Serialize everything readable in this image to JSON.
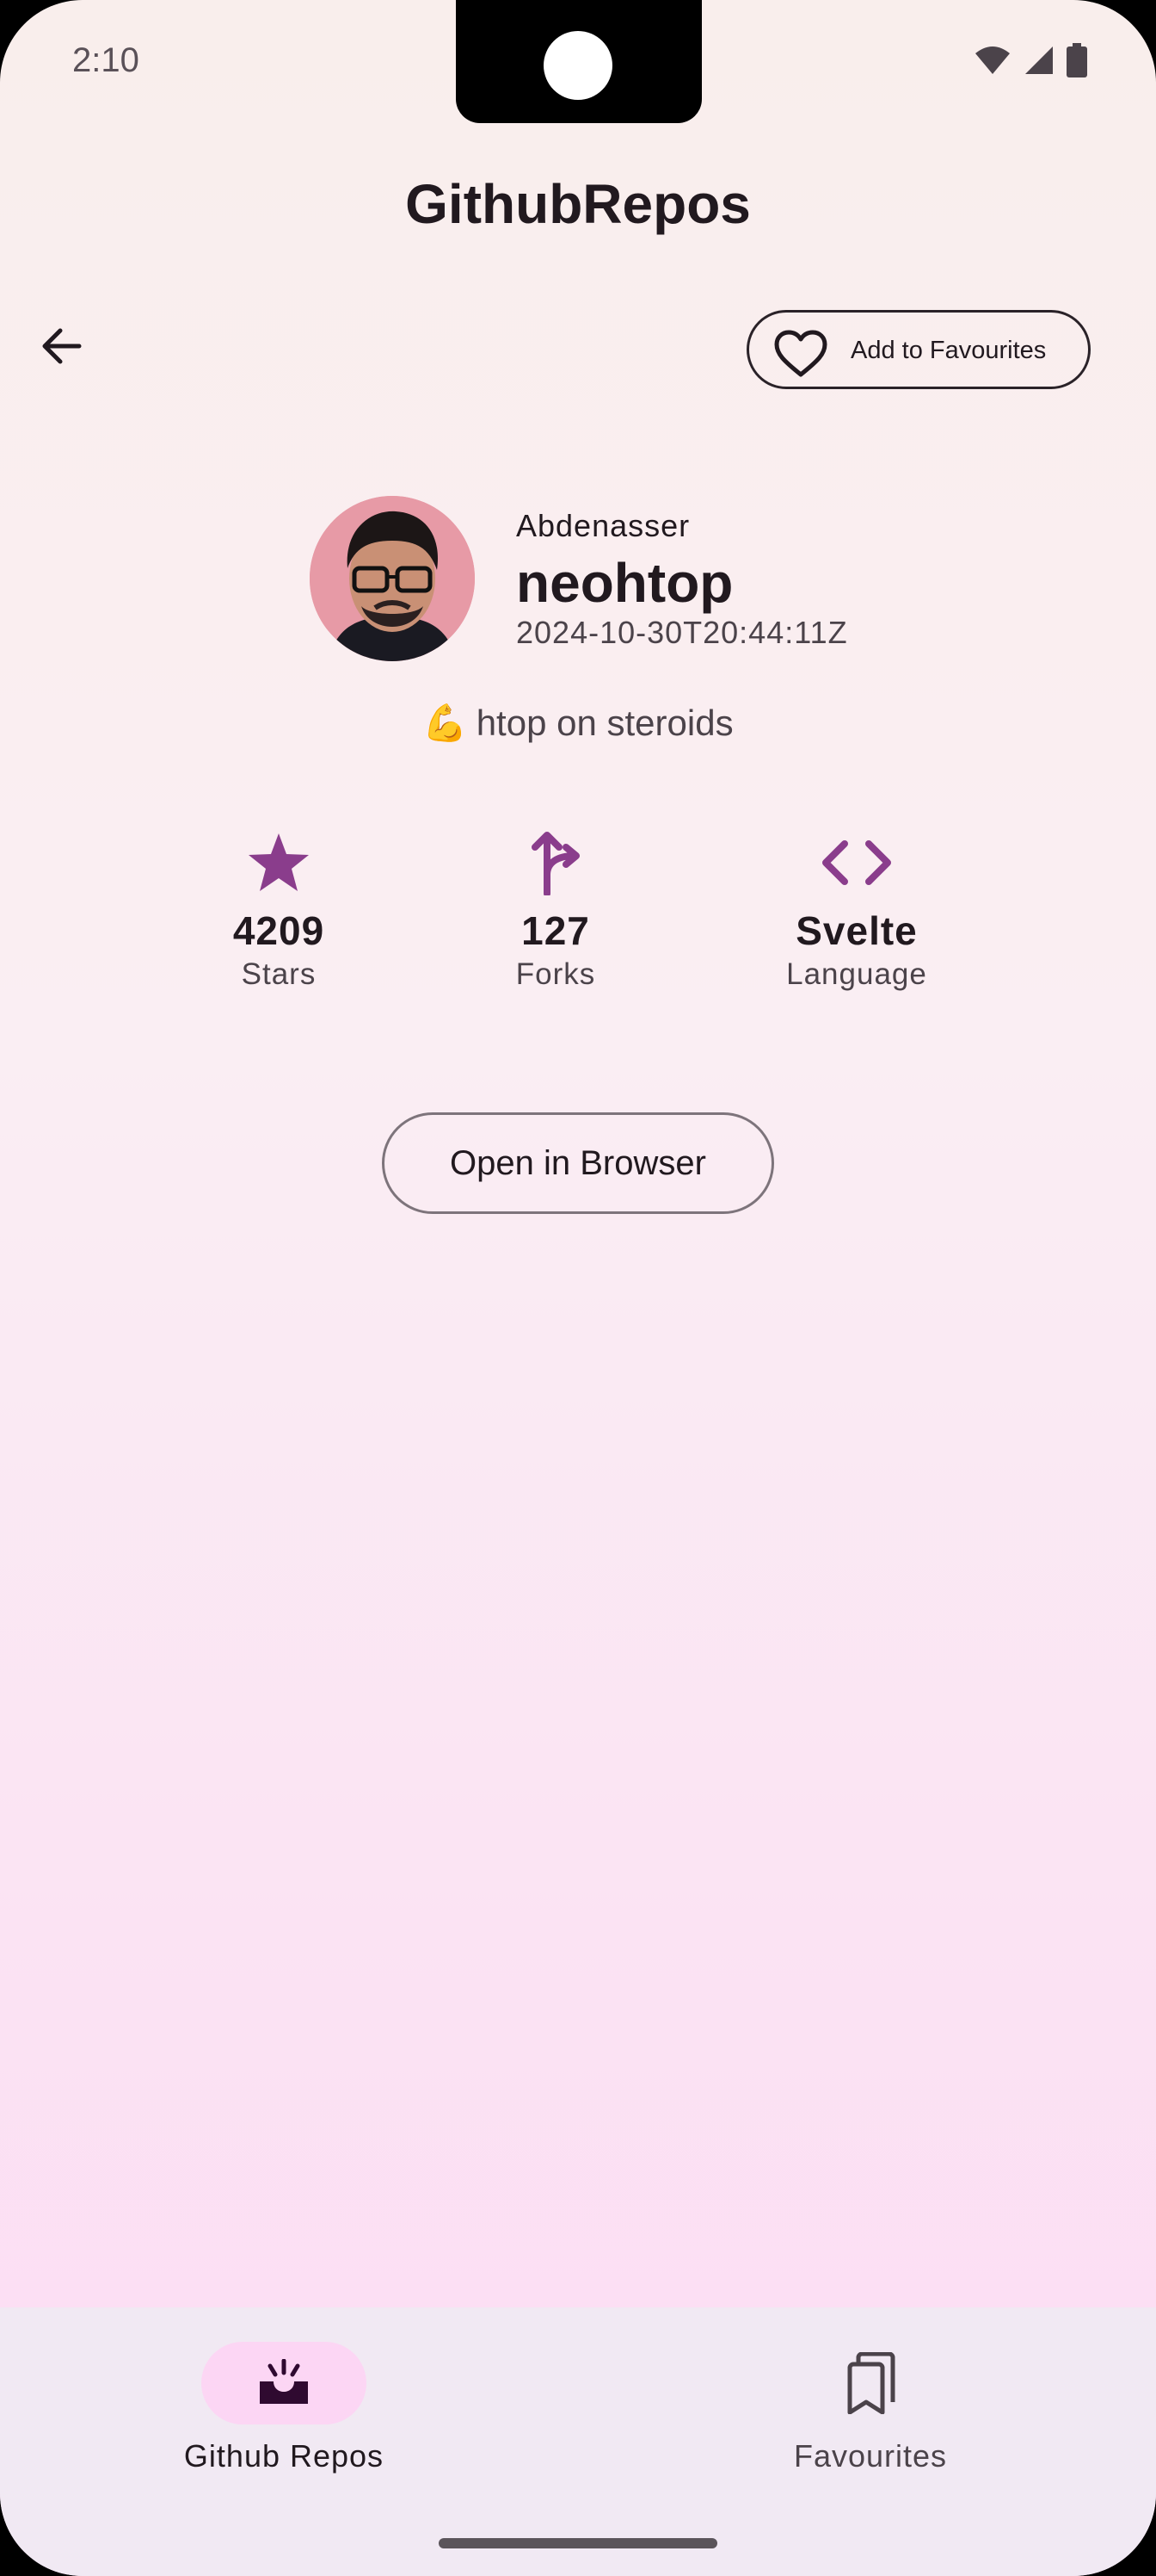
{
  "status_bar": {
    "time": "2:10"
  },
  "app_bar": {
    "title": "GithubRepos"
  },
  "actions": {
    "favourite_label": "Add to Favourites"
  },
  "repo": {
    "owner": "Abdenasser",
    "name": "neohtop",
    "updated_at": "2024-10-30T20:44:11Z",
    "description_emoji": "💪",
    "description": "htop on steroids"
  },
  "stats": {
    "stars": {
      "value": "4209",
      "label": "Stars"
    },
    "forks": {
      "value": "127",
      "label": "Forks"
    },
    "language": {
      "value": "Svelte",
      "label": "Language"
    }
  },
  "open_browser_label": "Open in Browser",
  "bottom_nav": {
    "items": [
      {
        "label": "Github Repos",
        "icon": "inbox-tray-icon",
        "selected": true
      },
      {
        "label": "Favourites",
        "icon": "bookmarks-icon",
        "selected": false
      }
    ]
  },
  "colors": {
    "accent": "#8a3d8c",
    "nav_selected_pill": "#fcd6f4",
    "nav_background": "#f1e9f3",
    "text_primary": "#21191f"
  }
}
